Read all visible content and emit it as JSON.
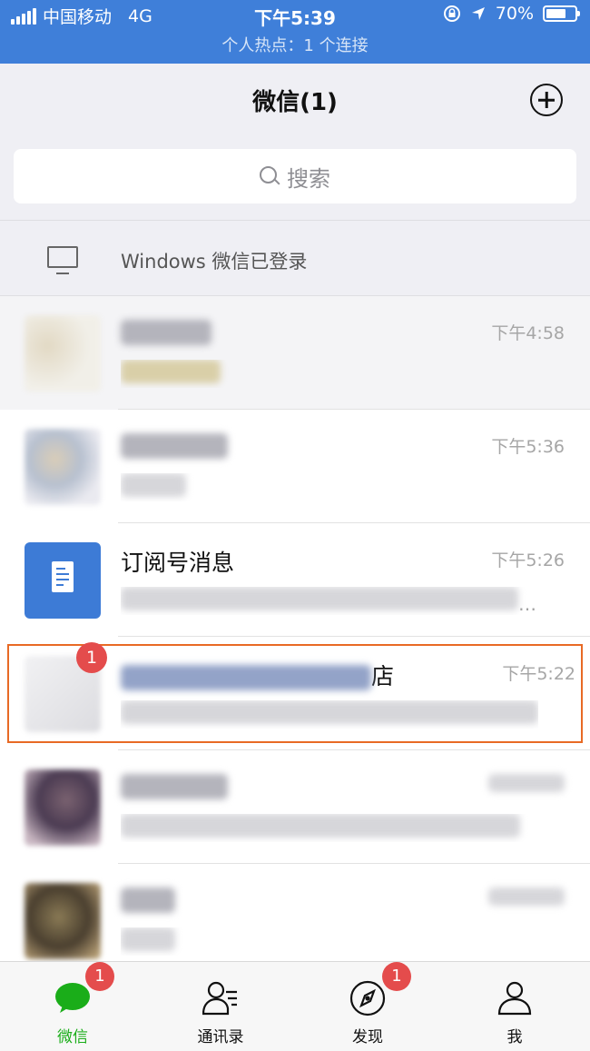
{
  "status_bar": {
    "carrier": "中国移动",
    "network": "4G",
    "time": "下午5:39",
    "battery": "70%",
    "battery_level": 0.7,
    "hotspot": "个人热点：1 个连接"
  },
  "header": {
    "title": "微信(1)",
    "add_icon": "plus-circle-icon"
  },
  "search": {
    "placeholder": "搜索"
  },
  "login_notice": {
    "icon": "monitor-icon",
    "text": "Windows 微信已登录"
  },
  "chats": [
    {
      "time": "下午4:58",
      "pinned": true
    },
    {
      "time": "下午5:36"
    },
    {
      "name": "订阅号消息",
      "time": "下午5:26",
      "message_suffix": "…",
      "icon": "document-icon"
    },
    {
      "name_suffix": "店",
      "time": "下午5:22",
      "badge": "1",
      "highlighted": true,
      "highlight_color": "#e86a25"
    },
    {
      "time": ""
    },
    {
      "time": ""
    }
  ],
  "tabbar": {
    "active_color": "#1aad19",
    "badge_color": "#e44c4c",
    "tabs": [
      {
        "label": "微信",
        "icon": "chat-bubble-icon",
        "badge": "1",
        "active": true
      },
      {
        "label": "通讯录",
        "icon": "contacts-icon"
      },
      {
        "label": "发现",
        "icon": "compass-icon",
        "badge": "1"
      },
      {
        "label": "我",
        "icon": "person-icon"
      }
    ]
  }
}
